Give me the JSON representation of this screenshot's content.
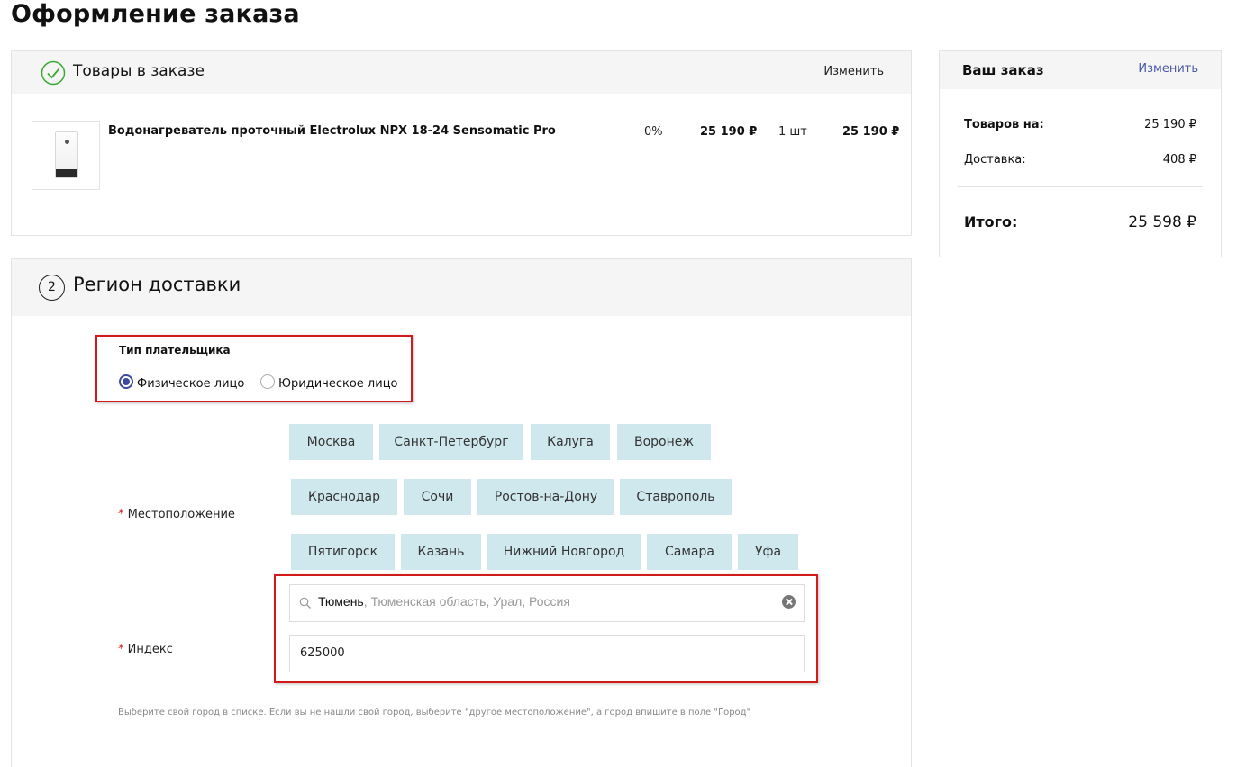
{
  "page": {
    "title": "Оформление заказа"
  },
  "products_section": {
    "title": "Товары в заказе",
    "edit_label": "Изменить",
    "items": [
      {
        "name": "Водонагреватель проточный Electrolux NPX 18-24 Sensomatic Pro",
        "discount": "0%",
        "price": "25 190 ₽",
        "quantity": "1 шт",
        "total": "25 190 ₽"
      }
    ]
  },
  "order_summary": {
    "title": "Ваш заказ",
    "edit_label": "Изменить",
    "goods_label": "Товаров на:",
    "goods_value": "25 190 ₽",
    "delivery_label": "Доставка:",
    "delivery_value": "408 ₽",
    "total_label": "Итого:",
    "total_value": "25 598 ₽"
  },
  "region_section": {
    "step": "2",
    "title": "Регион доставки",
    "payer_type": {
      "title": "Тип плательщика",
      "options": [
        "Физическое лицо",
        "Юридическое лицо"
      ],
      "selected": "Физическое лицо"
    },
    "cities": [
      "Москва",
      "Санкт-Петербург",
      "Калуга",
      "Воронеж",
      "Краснодар",
      "Сочи",
      "Ростов-на-Дону",
      "Ставрополь",
      "Пятигорск",
      "Казань",
      "Нижний Новгород",
      "Самара",
      "Уфа"
    ],
    "location_label": "Местоположение",
    "required_mark": "*",
    "location_city": "Тюмень",
    "location_rest": ", Тюменская область, Урал, Россия",
    "index_label": "Индекс",
    "index_value": "625000",
    "hint": "Выберите свой город в списке. Если вы не нашли свой город, выберите \"другое местоположение\", а город впишите в поле \"Город\""
  },
  "colors": {
    "accent": "#3b4aa0",
    "city_button_bg": "#cfe8ed",
    "highlight_border": "#d11a1a",
    "link": "#4a58a8",
    "check_green": "#3aaa35"
  },
  "icons": [
    "check-circle-icon",
    "search-icon",
    "clear-icon",
    "product-image"
  ]
}
